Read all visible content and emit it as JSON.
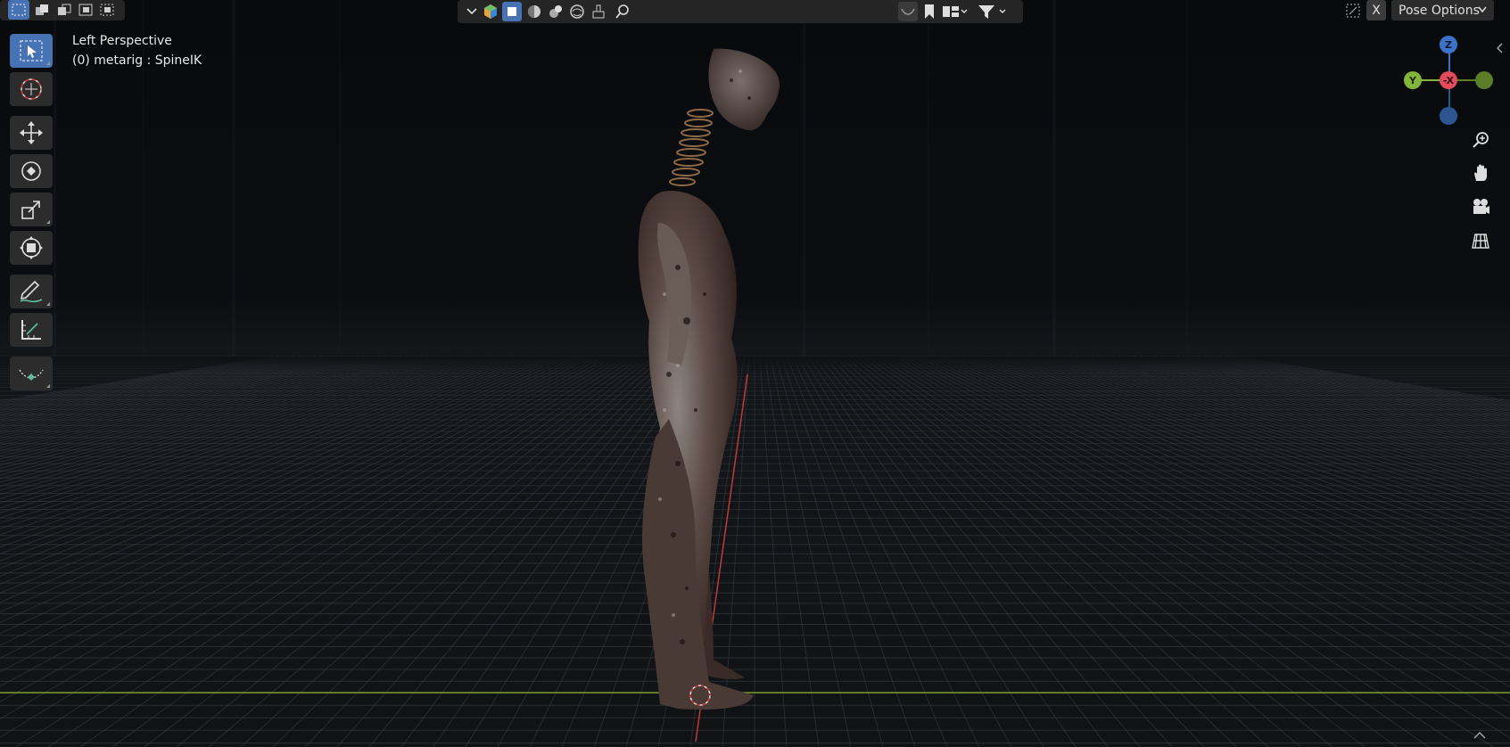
{
  "viewport": {
    "view_name": "Left Perspective",
    "object_info": "(0) metarig : SpineIK"
  },
  "header_left": {
    "select_modes": [
      "select-new-icon",
      "select-extend-icon",
      "select-subtract-icon",
      "select-difference-icon",
      "select-intersect-icon"
    ]
  },
  "header_center": {
    "dropdown_icon": "chevron-down-icon",
    "icons": [
      "object-type-visibility-icon",
      "selectability-icon",
      "solid-shading-icon",
      "material-shading-icon",
      "rendered-shading-icon",
      "brush-icon"
    ],
    "search_icon": "search-icon",
    "right_icons": [
      "curve-icon",
      "bookmark-icon",
      "layout-icon",
      "filter-icon"
    ]
  },
  "header_right": {
    "x_toggle_label": "X",
    "pose_options_label": "Pose Options"
  },
  "toolbar": {
    "tools": [
      "select-box",
      "cursor",
      "move",
      "rotate",
      "scale",
      "transform",
      "annotate",
      "measure",
      "bone-relax"
    ]
  },
  "gizmo": {
    "z_label": "Z",
    "y_label": "Y",
    "x_label": "-X",
    "colors": {
      "z": "#3a73c8",
      "y": "#83b53a",
      "x": "#e34a5b",
      "neg_y": "#5a7d28",
      "neg_z": "#2d5590"
    }
  },
  "nav_buttons": [
    "zoom-icon",
    "hand-pan-icon",
    "camera-icon",
    "grid-view-icon"
  ]
}
